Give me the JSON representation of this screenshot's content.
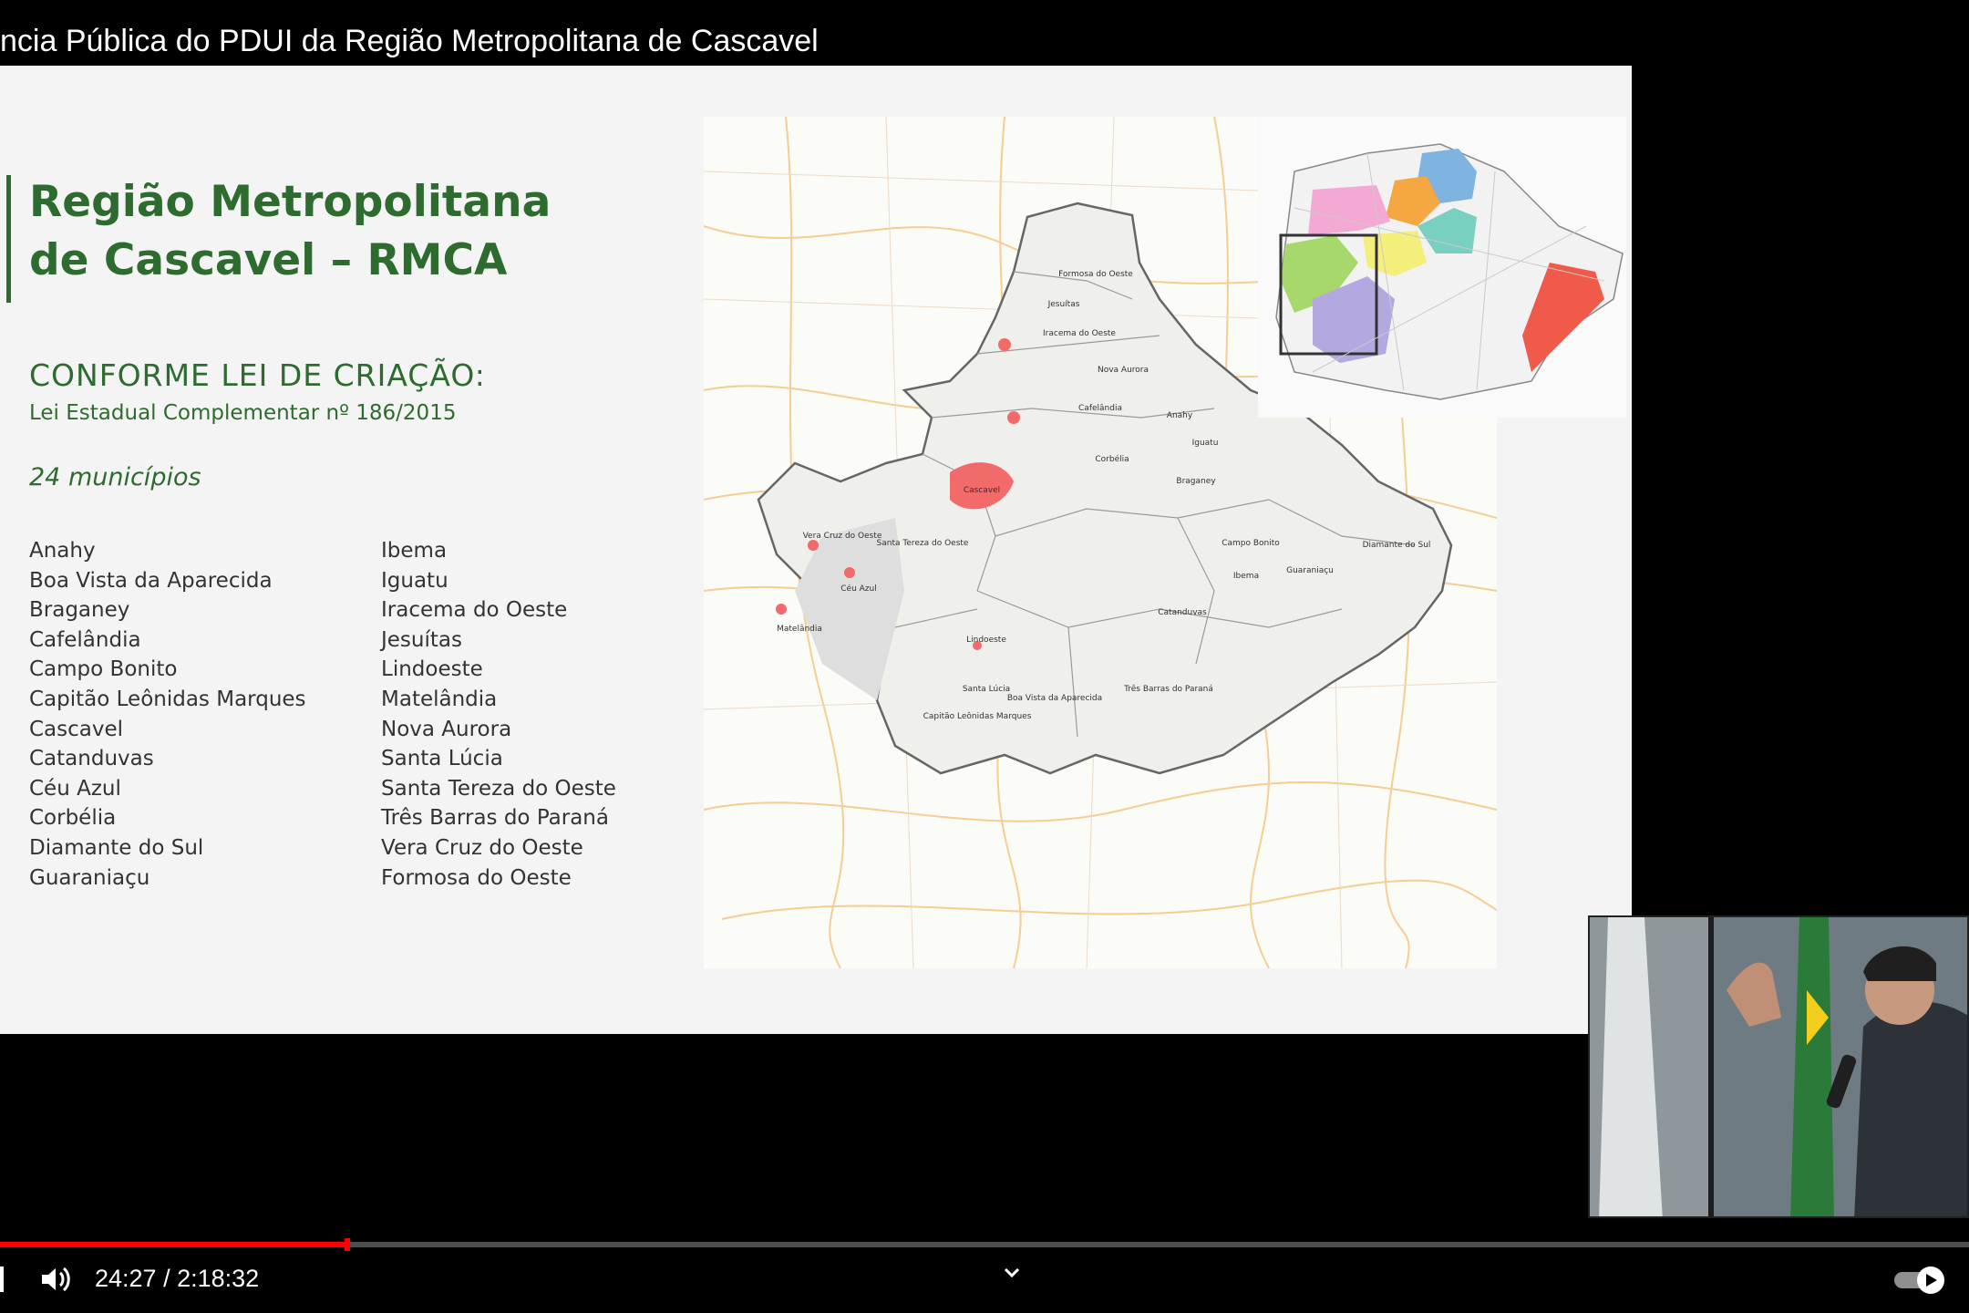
{
  "video": {
    "title": "ncia Pública do PDUI da Região Metropolitana de Cascavel",
    "current_time": "24:27",
    "duration": "2:18:32",
    "time_display": "24:27 / 2:18:32",
    "progress_fraction": 0.1764
  },
  "slide": {
    "heading_line1": "Região Metropolitana",
    "heading_line2": "de Cascavel – RMCA",
    "law_title": "CONFORME LEI DE CRIAÇÃO:",
    "law_subtitle": "Lei Estadual Complementar nº 186/2015",
    "municipality_count": "24 municípios",
    "municipalities_col1": [
      "Anahy",
      "Boa Vista da Aparecida",
      "Braganey",
      "Cafelândia",
      "Campo Bonito",
      "Capitão Leônidas Marques",
      "Cascavel",
      "Catanduvas",
      "Céu Azul",
      "Corbélia",
      "Diamante do Sul",
      "Guaraniaçu"
    ],
    "municipalities_col2": [
      "Ibema",
      "Iguatu",
      "Iracema do Oeste",
      "Jesuítas",
      "Lindoeste",
      "Matelândia",
      "Nova Aurora",
      "Santa Lúcia",
      "Santa Tereza do Oeste",
      "Três Barras do Paraná",
      "Vera Cruz do Oeste",
      "Formosa do Oeste"
    ]
  },
  "map_labels": {
    "cascavel": "Cascavel",
    "formosa": "Formosa do Oeste",
    "jesuitas": "Jesuítas",
    "iracema": "Iracema do Oeste",
    "nova_aurora": "Nova Aurora",
    "cafelandia": "Cafelândia",
    "anahy": "Anahy",
    "iguatu": "Iguatu",
    "corbelia": "Corbélia",
    "braganey": "Braganey",
    "vera_cruz": "Vera Cruz do Oeste",
    "santa_tereza": "Santa Tereza do Oeste",
    "ceu_azul": "Céu Azul",
    "matelandia": "Matelândia",
    "campo_bonito": "Campo Bonito",
    "diamante": "Diamante do Sul",
    "guaraniacu": "Guaraniaçu",
    "ibema": "Ibema",
    "catanduvas": "Catanduvas",
    "lindoeste": "Lindoeste",
    "santa_lucia": "Santa Lúcia",
    "boa_vista": "Boa Vista da Aparecida",
    "tres_barras": "Três Barras do Paraná",
    "capitao": "Capitão Leônidas Marques"
  },
  "colors": {
    "brand_green": "#2e6b2f",
    "progress_red": "#ff0000",
    "urban_area": "#f26a6a",
    "roads": "#f5c27a"
  },
  "icons": {
    "volume": "volume-icon",
    "chevron": "chevron-down-icon",
    "autoplay": "autoplay-toggle-icon"
  }
}
